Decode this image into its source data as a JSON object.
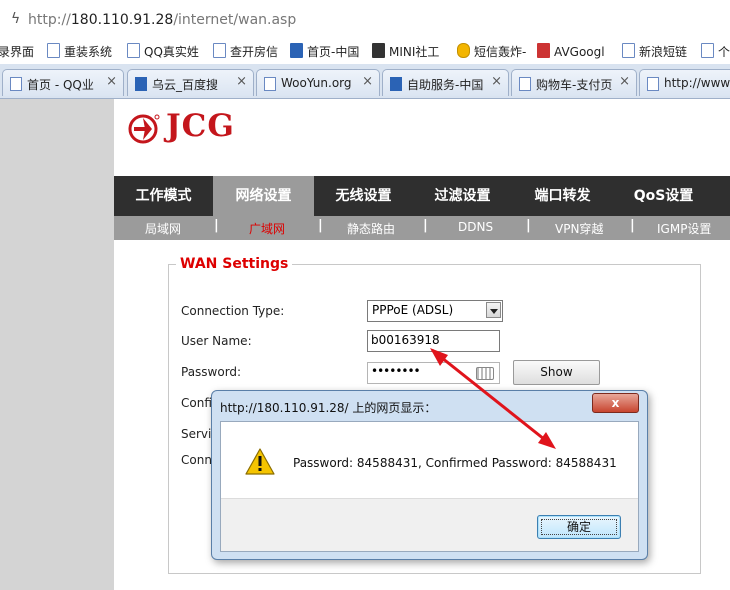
{
  "browser": {
    "url_prefix": "http://",
    "url_host": "180.110.91.28",
    "url_path": "/internet/wan.asp",
    "bookmarks": [
      "录界面",
      "重装系统",
      "QQ真实姓",
      "查开房信",
      "首页-中国",
      "MINI社工",
      "短信轰炸-",
      "AVGoogl",
      "新浪短链",
      "个"
    ],
    "tabs": [
      "首页 - QQ业",
      "乌云_百度搜",
      "WooYun.org",
      "自助服务-中国",
      "购物车-支付页",
      "http://www.w"
    ]
  },
  "router": {
    "brand": "JCG",
    "main_nav": [
      "工作模式",
      "网络设置",
      "无线设置",
      "过滤设置",
      "端口转发",
      "QoS设置"
    ],
    "main_nav_active": "网络设置",
    "sub_nav": [
      "局域网",
      "广域网",
      "静态路由",
      "DDNS",
      "VPN穿越",
      "IGMP设置"
    ],
    "sub_nav_active": "广域网",
    "sub_nav_separator": "|"
  },
  "wan": {
    "legend": "WAN Settings",
    "connection_type_label": "Connection Type:",
    "connection_type_value": "PPPoE (ADSL)",
    "username_label": "User Name:",
    "username_value": "b00163918",
    "password_label": "Password:",
    "password_mask": "••••••••",
    "show_button": "Show",
    "hidden_label_1": "Confi",
    "hidden_label_2": "Servi",
    "hidden_label_3": "Conn"
  },
  "dialog": {
    "title": "http://180.110.91.28/ 上的网页显示：",
    "message": "Password: 84588431, Confirmed Password: 84588431",
    "ok_button": "确定",
    "close_symbol": "x"
  },
  "colors": {
    "brand_red": "#c4161c",
    "nav_dark": "#2f2f2f",
    "nav_active": "#9b9b9b",
    "legend_red": "#dd0000",
    "annotation_arrow": "#e0141c"
  }
}
